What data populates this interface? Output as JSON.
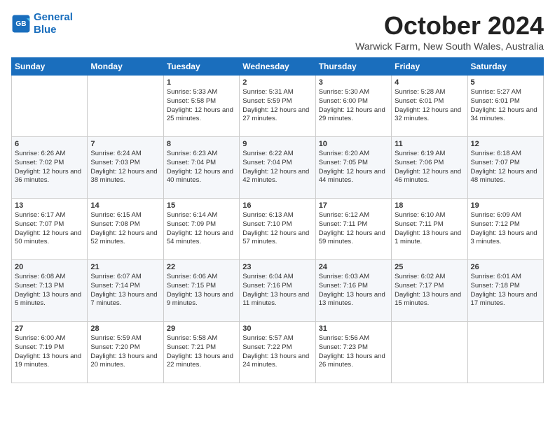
{
  "header": {
    "logo_line1": "General",
    "logo_line2": "Blue",
    "month": "October 2024",
    "location": "Warwick Farm, New South Wales, Australia"
  },
  "days_of_week": [
    "Sunday",
    "Monday",
    "Tuesday",
    "Wednesday",
    "Thursday",
    "Friday",
    "Saturday"
  ],
  "weeks": [
    [
      {
        "day": "",
        "info": ""
      },
      {
        "day": "",
        "info": ""
      },
      {
        "day": "1",
        "info": "Sunrise: 5:33 AM\nSunset: 5:58 PM\nDaylight: 12 hours\nand 25 minutes."
      },
      {
        "day": "2",
        "info": "Sunrise: 5:31 AM\nSunset: 5:59 PM\nDaylight: 12 hours\nand 27 minutes."
      },
      {
        "day": "3",
        "info": "Sunrise: 5:30 AM\nSunset: 6:00 PM\nDaylight: 12 hours\nand 29 minutes."
      },
      {
        "day": "4",
        "info": "Sunrise: 5:28 AM\nSunset: 6:01 PM\nDaylight: 12 hours\nand 32 minutes."
      },
      {
        "day": "5",
        "info": "Sunrise: 5:27 AM\nSunset: 6:01 PM\nDaylight: 12 hours\nand 34 minutes."
      }
    ],
    [
      {
        "day": "6",
        "info": "Sunrise: 6:26 AM\nSunset: 7:02 PM\nDaylight: 12 hours\nand 36 minutes."
      },
      {
        "day": "7",
        "info": "Sunrise: 6:24 AM\nSunset: 7:03 PM\nDaylight: 12 hours\nand 38 minutes."
      },
      {
        "day": "8",
        "info": "Sunrise: 6:23 AM\nSunset: 7:04 PM\nDaylight: 12 hours\nand 40 minutes."
      },
      {
        "day": "9",
        "info": "Sunrise: 6:22 AM\nSunset: 7:04 PM\nDaylight: 12 hours\nand 42 minutes."
      },
      {
        "day": "10",
        "info": "Sunrise: 6:20 AM\nSunset: 7:05 PM\nDaylight: 12 hours\nand 44 minutes."
      },
      {
        "day": "11",
        "info": "Sunrise: 6:19 AM\nSunset: 7:06 PM\nDaylight: 12 hours\nand 46 minutes."
      },
      {
        "day": "12",
        "info": "Sunrise: 6:18 AM\nSunset: 7:07 PM\nDaylight: 12 hours\nand 48 minutes."
      }
    ],
    [
      {
        "day": "13",
        "info": "Sunrise: 6:17 AM\nSunset: 7:07 PM\nDaylight: 12 hours\nand 50 minutes."
      },
      {
        "day": "14",
        "info": "Sunrise: 6:15 AM\nSunset: 7:08 PM\nDaylight: 12 hours\nand 52 minutes."
      },
      {
        "day": "15",
        "info": "Sunrise: 6:14 AM\nSunset: 7:09 PM\nDaylight: 12 hours\nand 54 minutes."
      },
      {
        "day": "16",
        "info": "Sunrise: 6:13 AM\nSunset: 7:10 PM\nDaylight: 12 hours\nand 57 minutes."
      },
      {
        "day": "17",
        "info": "Sunrise: 6:12 AM\nSunset: 7:11 PM\nDaylight: 12 hours\nand 59 minutes."
      },
      {
        "day": "18",
        "info": "Sunrise: 6:10 AM\nSunset: 7:11 PM\nDaylight: 13 hours\nand 1 minute."
      },
      {
        "day": "19",
        "info": "Sunrise: 6:09 AM\nSunset: 7:12 PM\nDaylight: 13 hours\nand 3 minutes."
      }
    ],
    [
      {
        "day": "20",
        "info": "Sunrise: 6:08 AM\nSunset: 7:13 PM\nDaylight: 13 hours\nand 5 minutes."
      },
      {
        "day": "21",
        "info": "Sunrise: 6:07 AM\nSunset: 7:14 PM\nDaylight: 13 hours\nand 7 minutes."
      },
      {
        "day": "22",
        "info": "Sunrise: 6:06 AM\nSunset: 7:15 PM\nDaylight: 13 hours\nand 9 minutes."
      },
      {
        "day": "23",
        "info": "Sunrise: 6:04 AM\nSunset: 7:16 PM\nDaylight: 13 hours\nand 11 minutes."
      },
      {
        "day": "24",
        "info": "Sunrise: 6:03 AM\nSunset: 7:16 PM\nDaylight: 13 hours\nand 13 minutes."
      },
      {
        "day": "25",
        "info": "Sunrise: 6:02 AM\nSunset: 7:17 PM\nDaylight: 13 hours\nand 15 minutes."
      },
      {
        "day": "26",
        "info": "Sunrise: 6:01 AM\nSunset: 7:18 PM\nDaylight: 13 hours\nand 17 minutes."
      }
    ],
    [
      {
        "day": "27",
        "info": "Sunrise: 6:00 AM\nSunset: 7:19 PM\nDaylight: 13 hours\nand 19 minutes."
      },
      {
        "day": "28",
        "info": "Sunrise: 5:59 AM\nSunset: 7:20 PM\nDaylight: 13 hours\nand 20 minutes."
      },
      {
        "day": "29",
        "info": "Sunrise: 5:58 AM\nSunset: 7:21 PM\nDaylight: 13 hours\nand 22 minutes."
      },
      {
        "day": "30",
        "info": "Sunrise: 5:57 AM\nSunset: 7:22 PM\nDaylight: 13 hours\nand 24 minutes."
      },
      {
        "day": "31",
        "info": "Sunrise: 5:56 AM\nSunset: 7:23 PM\nDaylight: 13 hours\nand 26 minutes."
      },
      {
        "day": "",
        "info": ""
      },
      {
        "day": "",
        "info": ""
      }
    ]
  ]
}
